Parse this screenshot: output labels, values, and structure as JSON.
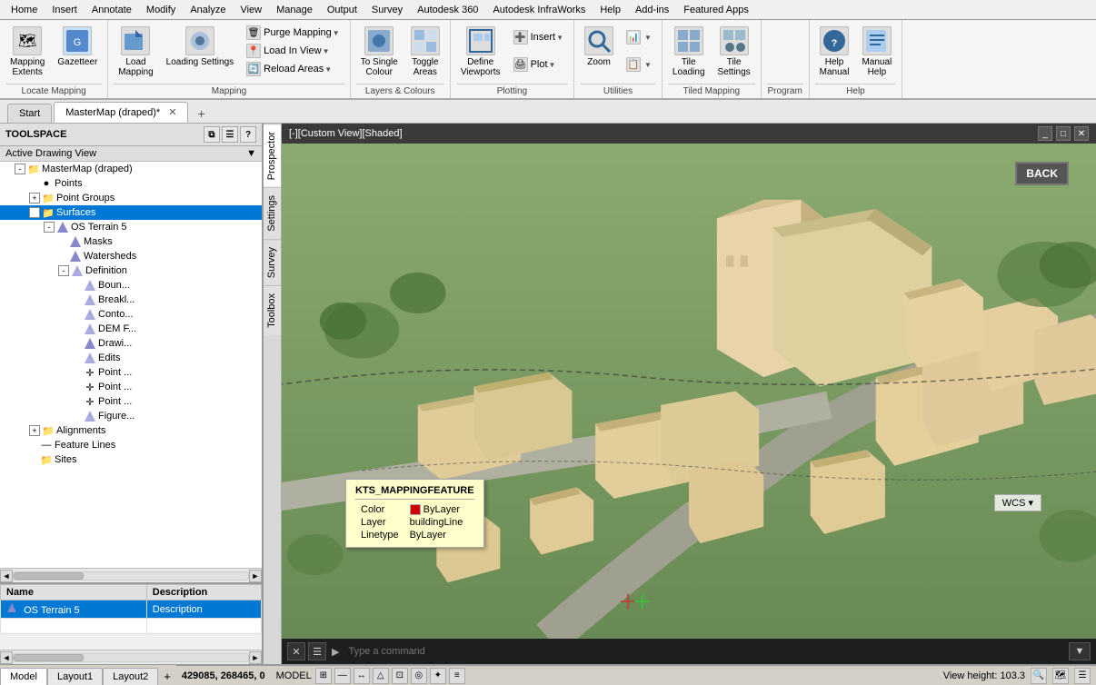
{
  "menubar": {
    "items": [
      "Home",
      "Insert",
      "Annotate",
      "Modify",
      "Analyze",
      "View",
      "Manage",
      "Output",
      "Survey",
      "Autodesk 360",
      "Autodesk InfraWorks",
      "Help",
      "Add-ins",
      "Featured Apps"
    ]
  },
  "ribbon": {
    "groups": [
      {
        "label": "Locate Mapping",
        "buttons": [
          {
            "label": "Mapping\nExtents",
            "icon": "🗺"
          },
          {
            "label": "Gazetteer",
            "icon": "📖"
          }
        ]
      },
      {
        "label": "Mapping",
        "buttons": [
          {
            "label": "Load\nMapping",
            "icon": "📂"
          },
          {
            "label": "Loading\nSettings",
            "icon": "⚙"
          },
          {
            "label": "Purge Mapping",
            "icon": "🗑"
          },
          {
            "label": "Load In View",
            "icon": "📍"
          },
          {
            "label": "Reload Areas",
            "icon": "🔄"
          }
        ]
      },
      {
        "label": "Layers & Colours",
        "buttons": [
          {
            "label": "To Single\nColour",
            "icon": "🎨"
          },
          {
            "label": "Toggle\nAreas",
            "icon": "⬜"
          }
        ]
      },
      {
        "label": "Plotting",
        "buttons": [
          {
            "label": "Define\nViewports",
            "icon": "📐"
          },
          {
            "label": "Insert",
            "icon": "➕"
          },
          {
            "label": "Plot",
            "icon": "🖨"
          }
        ]
      },
      {
        "label": "Utilities",
        "buttons": [
          {
            "label": "Zoom",
            "icon": "🔍"
          }
        ]
      },
      {
        "label": "Tiled Mapping",
        "buttons": [
          {
            "label": "Tile\nLoading",
            "icon": "⬛"
          },
          {
            "label": "Tile\nSettings",
            "icon": "⚙"
          }
        ]
      },
      {
        "label": "Program",
        "buttons": []
      },
      {
        "label": "Help",
        "buttons": [
          {
            "label": "Help\nManual",
            "icon": "❓"
          },
          {
            "label": "Manual\nHelp",
            "icon": "📘"
          }
        ]
      }
    ]
  },
  "tabs": {
    "items": [
      "Start",
      "MasterMap (draped)*"
    ],
    "active": 1
  },
  "toolspace": {
    "title": "TOOLSPACE",
    "view_dropdown": "Active Drawing View",
    "tree": {
      "items": [
        {
          "id": "mastermap",
          "label": "MasterMap (draped)",
          "level": 0,
          "icon": "📁",
          "expand": "-"
        },
        {
          "id": "points",
          "label": "Points",
          "level": 1,
          "icon": "•",
          "expand": null
        },
        {
          "id": "point-groups",
          "label": "Point Groups",
          "level": 1,
          "icon": "📁",
          "expand": "+"
        },
        {
          "id": "surfaces",
          "label": "Surfaces",
          "level": 1,
          "icon": "📁",
          "expand": "-",
          "selected": true
        },
        {
          "id": "os-terrain-5",
          "label": "OS Terrain 5",
          "level": 2,
          "icon": "🔷",
          "expand": "-"
        },
        {
          "id": "masks",
          "label": "Masks",
          "level": 3,
          "icon": "🔹",
          "expand": null
        },
        {
          "id": "watersheds",
          "label": "Watersheds",
          "level": 3,
          "icon": "🔹",
          "expand": null
        },
        {
          "id": "definition",
          "label": "Definition",
          "level": 3,
          "icon": "🔷",
          "expand": "-"
        },
        {
          "id": "boun",
          "label": "Boun...",
          "level": 4,
          "icon": "🔹",
          "expand": null
        },
        {
          "id": "breakl",
          "label": "Breakl...",
          "level": 4,
          "icon": "🔹",
          "expand": null
        },
        {
          "id": "conto",
          "label": "Conto...",
          "level": 4,
          "icon": "🔹",
          "expand": null
        },
        {
          "id": "dem-f",
          "label": "DEM F...",
          "level": 4,
          "icon": "🔹",
          "expand": null
        },
        {
          "id": "drawi",
          "label": "Drawi...",
          "level": 4,
          "icon": "🔷",
          "expand": null
        },
        {
          "id": "edits",
          "label": "Edits",
          "level": 4,
          "icon": "🔹",
          "expand": null
        },
        {
          "id": "point1",
          "label": "Point ...",
          "level": 4,
          "icon": "✛",
          "expand": null
        },
        {
          "id": "point2",
          "label": "Point ...",
          "level": 4,
          "icon": "✛",
          "expand": null
        },
        {
          "id": "point3",
          "label": "Point ...",
          "level": 4,
          "icon": "✛",
          "expand": null
        },
        {
          "id": "figure",
          "label": "Figure...",
          "level": 4,
          "icon": "🔹",
          "expand": null
        },
        {
          "id": "alignments",
          "label": "Alignments",
          "level": 1,
          "icon": "📁",
          "expand": "+"
        },
        {
          "id": "feature-lines",
          "label": "Feature Lines",
          "level": 1,
          "icon": "—",
          "expand": null
        },
        {
          "id": "sites",
          "label": "Sites",
          "level": 1,
          "icon": "📁",
          "expand": null
        }
      ]
    }
  },
  "bottom_panel": {
    "columns": [
      "Name",
      "Description"
    ],
    "rows": [
      {
        "name": "OS Terrain 5",
        "description": "Description",
        "selected": true
      }
    ]
  },
  "viewport": {
    "title": "[-][Custom View][Shaded]",
    "back_btn": "BACK",
    "wcs": "WCS",
    "command_placeholder": "Type a command"
  },
  "feature_tooltip": {
    "title": "KTS_MAPPINGFEATURE",
    "rows": [
      {
        "key": "Color",
        "value": "ByLayer",
        "swatch": true,
        "swatch_color": "#cc0000"
      },
      {
        "key": "Layer",
        "value": "buildingLine"
      },
      {
        "key": "Linetype",
        "value": "ByLayer"
      }
    ]
  },
  "status_bar": {
    "coords": "429085, 268465, 0",
    "model_label": "MODEL",
    "view_height": "View height: 103.3",
    "tabs": [
      "Model",
      "Layout1",
      "Layout2"
    ]
  },
  "side_tabs": [
    "Prospector",
    "Settings",
    "Survey",
    "Toolbox"
  ]
}
